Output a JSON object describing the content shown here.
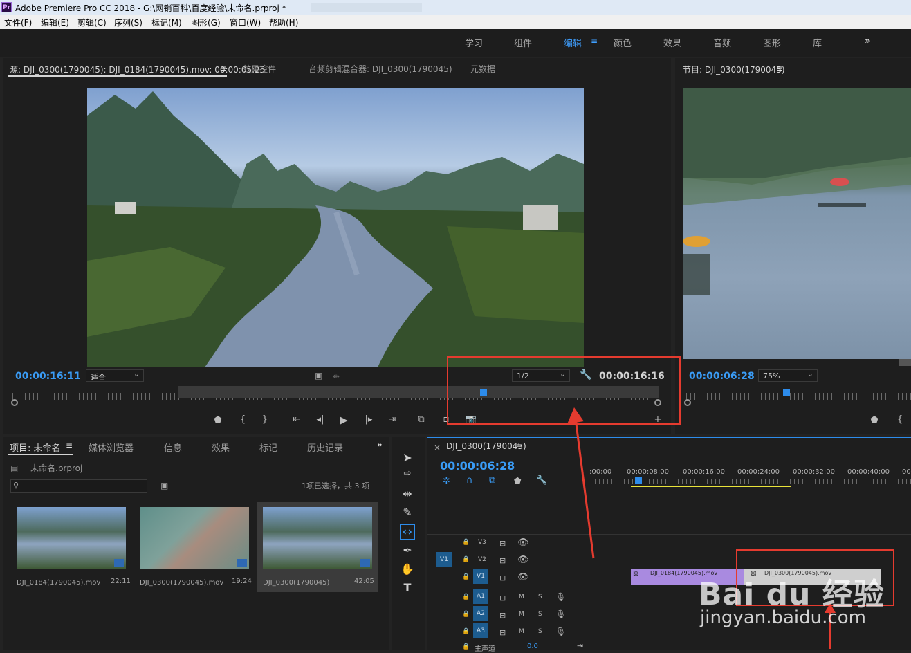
{
  "title_bar": {
    "app_icon": "Pr",
    "title": "Adobe Premiere Pro CC 2018 - G:\\网销百科\\百度经验\\未命名.prproj *"
  },
  "menu": [
    "文件(F)",
    "编辑(E)",
    "剪辑(C)",
    "序列(S)",
    "标记(M)",
    "图形(G)",
    "窗口(W)",
    "帮助(H)"
  ],
  "workspaces": {
    "items": [
      "学习",
      "组件",
      "编辑",
      "颜色",
      "效果",
      "音频",
      "图形",
      "库"
    ],
    "active": "编辑",
    "overflow": "»"
  },
  "source_panel": {
    "tabs": [
      "源: DJI_0300(1790045): DJI_0184(1790045).mov: 00:00:05:25",
      "效果控件",
      "音频剪辑混合器: DJI_0300(1790045)",
      "元数据"
    ],
    "timecode_left": "00:00:16:11",
    "fit": "适合",
    "resolution": "1/2",
    "timecode_right": "00:00:16:16"
  },
  "program_panel": {
    "tab": "节目: DJI_0300(1790045)",
    "timecode": "00:00:06:28",
    "zoom": "75%"
  },
  "project_panel": {
    "tabs": [
      "项目: 未命名",
      "媒体浏览器",
      "信息",
      "效果",
      "标记",
      "历史记录"
    ],
    "file": "未命名.prproj",
    "selection": "1项已选择，共 3 项",
    "search_placeholder": "",
    "items": [
      {
        "name": "DJI_0184(1790045).mov",
        "duration": "22:11"
      },
      {
        "name": "DJI_0300(1790045).mov",
        "duration": "19:24"
      },
      {
        "name": "DJI_0300(1790045)",
        "duration": "42:05"
      }
    ]
  },
  "timeline": {
    "tab": "DJI_0300(1790045)",
    "timecode": "00:00:06:28",
    "ruler": [
      ":00:00",
      "00:00:08:00",
      "00:00:16:00",
      "00:00:24:00",
      "00:00:32:00",
      "00:00:40:00",
      "00"
    ],
    "tracks": [
      "V3",
      "V2",
      "V1",
      "A1",
      "A2",
      "A3"
    ],
    "source_patch": "V1",
    "mute": "M",
    "solo": "S",
    "master": "主声道",
    "master_value": "0.0",
    "clips": [
      {
        "label": "DJI_0184(1790045).mov",
        "color": "#a98ae0"
      },
      {
        "label": "DJI_0300(1790045).mov",
        "color": "#cfcfcf"
      }
    ]
  },
  "watermark": {
    "brand": "Bai du 经验",
    "url": "jingyan.baidu.com"
  },
  "colors": {
    "accent": "#3a9cf6",
    "annotation": "#e53b2f"
  }
}
